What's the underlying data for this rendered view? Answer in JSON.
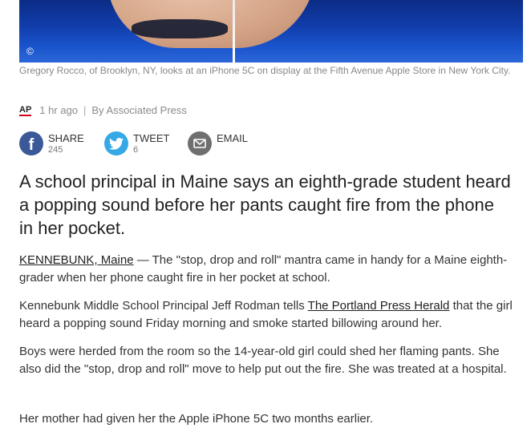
{
  "photo": {
    "copyright": "©",
    "caption": "Gregory Rocco, of Brooklyn, NY, looks at an iPhone 5C on display at the Fifth Avenue Apple Store in New York City."
  },
  "meta": {
    "source_logo": "AP",
    "time": "1 hr ago",
    "separator": "|",
    "byline": "By Associated Press"
  },
  "share": {
    "facebook": {
      "label": "SHARE",
      "count": "245",
      "icon": "facebook-icon"
    },
    "twitter": {
      "label": "TWEET",
      "count": "6",
      "icon": "twitter-icon"
    },
    "email": {
      "label": "EMAIL",
      "icon": "email-icon"
    }
  },
  "article": {
    "lede": "A school principal in Maine says an eighth-grade student heard a popping sound before her pants caught fire from the phone in her pocket.",
    "p1": {
      "dateline": "KENNEBUNK, Maine",
      "text": " — The \"stop, drop and roll\" mantra came in handy for a Maine eighth-grader when her phone caught fire in her pocket at school."
    },
    "p2": {
      "before": "Kennebunk Middle School Principal Jeff Rodman tells ",
      "link": "The Portland Press Herald",
      "after": " that the girl heard a popping sound Friday morning and smoke started billowing around her."
    },
    "p3": "Boys were herded from the room so the 14-year-old girl could shed her flaming pants. She also did the \"stop, drop and roll\" move to help put out the fire. She was treated at a hospital.",
    "p4": "Her mother had given her the Apple iPhone 5C two months earlier."
  },
  "colors": {
    "facebook": "#3b5998",
    "twitter": "#35a9e6",
    "email": "#6f6f6f",
    "ap_underline": "#d0021b"
  }
}
